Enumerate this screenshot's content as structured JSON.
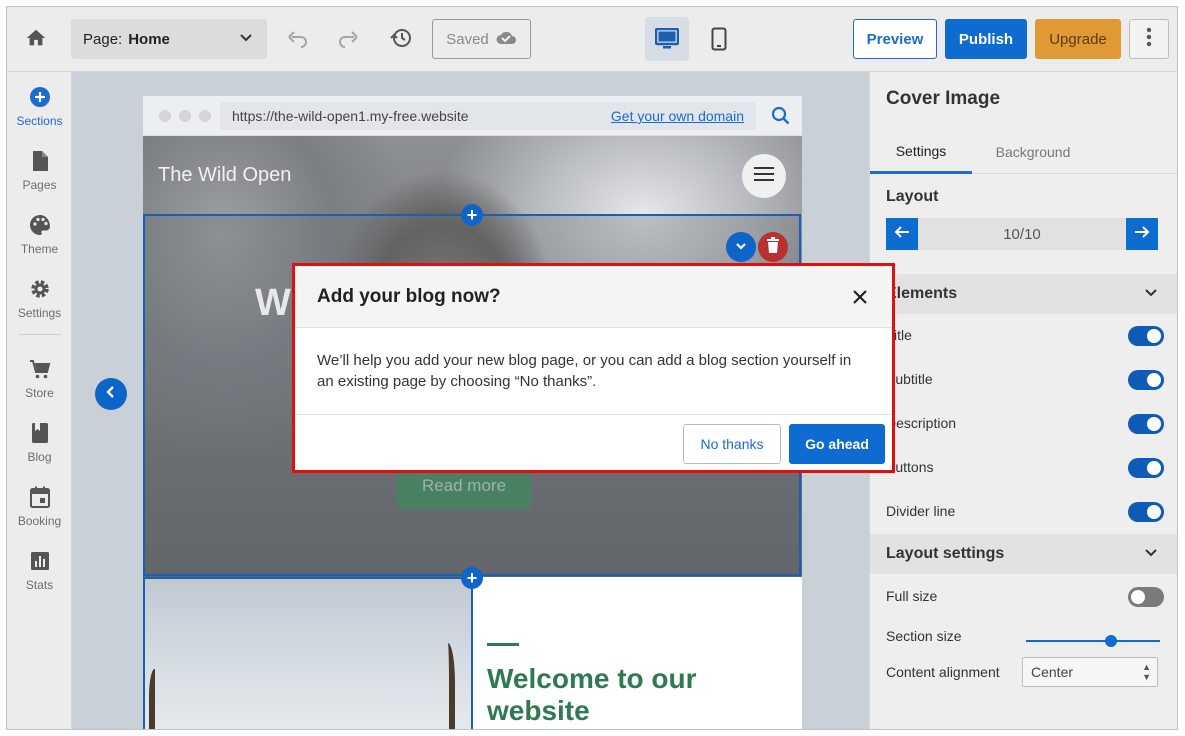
{
  "toolbar": {
    "page_label": "Page:",
    "page_value": "Home",
    "saved_label": "Saved",
    "preview_label": "Preview",
    "publish_label": "Publish",
    "upgrade_label": "Upgrade"
  },
  "sidebar": {
    "items": [
      {
        "label": "Sections",
        "icon": "plus-circle-icon"
      },
      {
        "label": "Pages",
        "icon": "page-icon"
      },
      {
        "label": "Theme",
        "icon": "palette-icon"
      },
      {
        "label": "Settings",
        "icon": "gear-icon"
      },
      {
        "label": "Store",
        "icon": "cart-icon"
      },
      {
        "label": "Blog",
        "icon": "book-icon"
      },
      {
        "label": "Booking",
        "icon": "calendar-icon"
      },
      {
        "label": "Stats",
        "icon": "chart-icon"
      }
    ]
  },
  "browser": {
    "url": "https://the-wild-open1.my-free.website",
    "domain_link": "Get your own domain"
  },
  "site": {
    "title": "The Wild Open",
    "hero_heading_fragment": "W",
    "read_more": "Read more",
    "welcome": "Welcome to our website"
  },
  "panel": {
    "title": "Cover Image",
    "tabs": [
      "Settings",
      "Background"
    ],
    "layout_label": "Layout",
    "layout_value": "10/10",
    "elements_header": "Elements",
    "elements": [
      {
        "label": "Title",
        "on": true
      },
      {
        "label": "Subtitle",
        "on": true
      },
      {
        "label": "Description",
        "on": true
      },
      {
        "label": "Buttons",
        "on": true
      },
      {
        "label": "Divider line",
        "on": true
      }
    ],
    "layout_settings_header": "Layout settings",
    "full_size_label": "Full size",
    "full_size_on": false,
    "section_size_label": "Section size",
    "section_size_value": 0.65,
    "content_alignment_label": "Content alignment",
    "content_alignment_value": "Center"
  },
  "modal": {
    "title": "Add your blog now?",
    "body": "We’ll help you add your new blog page, or you can add a blog section yourself in an existing page by choosing “No thanks”.",
    "no_thanks": "No thanks",
    "go_ahead": "Go ahead"
  },
  "colors": {
    "primary": "#0e6bd0",
    "upgrade": "#df9a34",
    "accent_green": "#2f7a50",
    "modal_outline": "#e01010"
  }
}
